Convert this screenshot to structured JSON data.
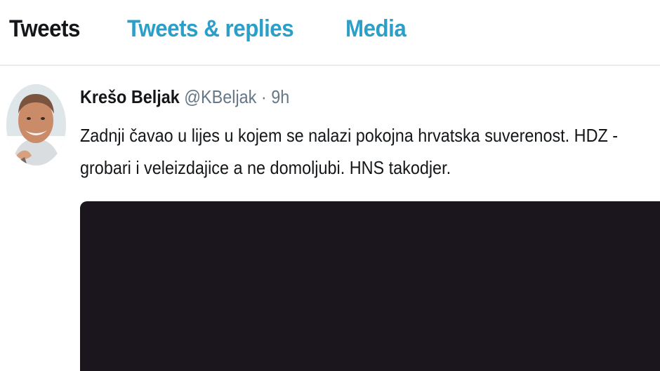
{
  "tabs": [
    {
      "label": "Tweets",
      "active": true
    },
    {
      "label": "Tweets & replies",
      "active": false
    },
    {
      "label": "Media",
      "active": false
    }
  ],
  "tweet": {
    "display_name": "Krešo Beljak",
    "handle": "@KBeljak",
    "separator": "·",
    "time": "9h",
    "text_line1": "Zadnji čavao u lijes u kojem se nalazi pokojna hrvatska suverenost. HDZ -",
    "text_line2": "grobari i veleizdajice a ne domoljubi. HNS takodjer."
  },
  "colors": {
    "accent": "#2b9fc8",
    "text": "#14171a",
    "muted": "#657786",
    "divider": "#e6ecf0",
    "media_bg": "#1b161d"
  },
  "icons": {
    "avatar": "profile-photo"
  }
}
